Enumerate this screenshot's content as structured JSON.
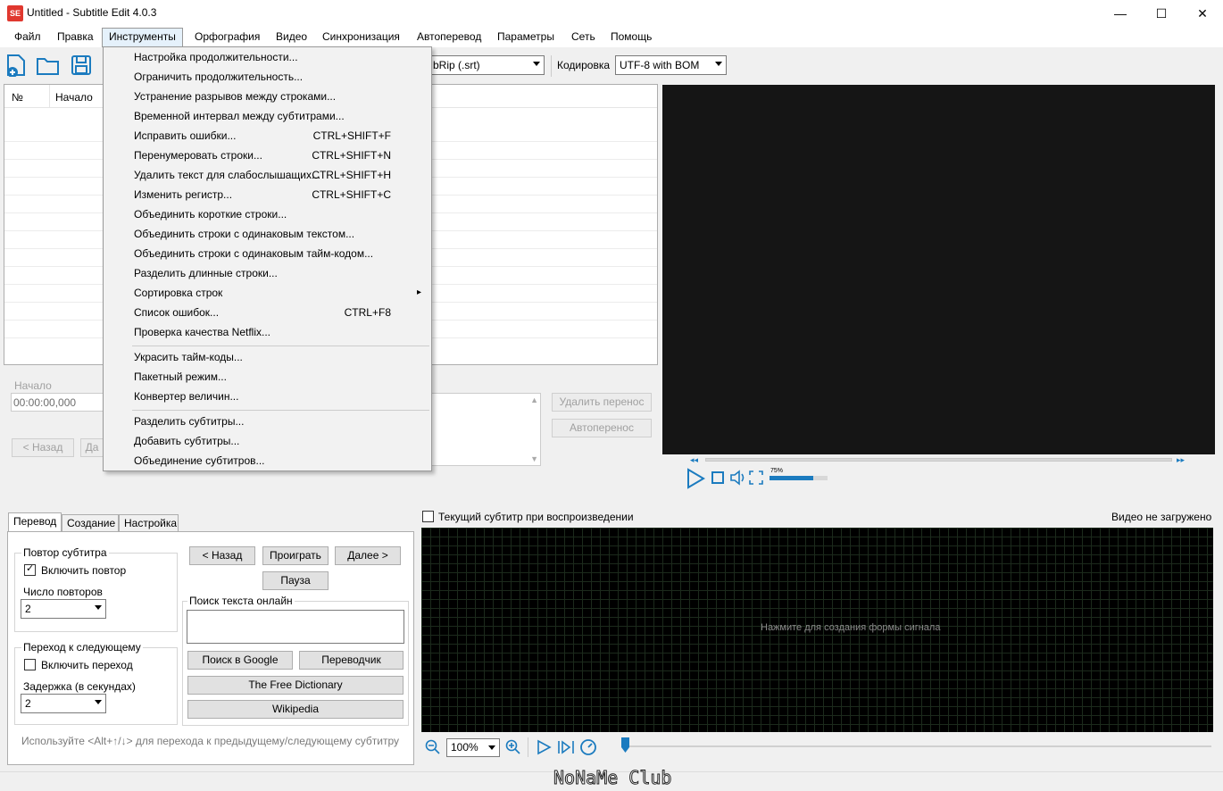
{
  "window": {
    "app_icon_text": "SE",
    "title": "Untitled - Subtitle Edit 4.0.3",
    "minimize": "—",
    "maximize": "☐",
    "close": "✕"
  },
  "menubar": {
    "items": [
      "Файл",
      "Правка",
      "Инструменты",
      "Орфография",
      "Видео",
      "Синхронизация",
      "Автоперевод",
      "Параметры",
      "Сеть",
      "Помощь"
    ]
  },
  "toolbar": {
    "format_value": "SubRip (.srt)",
    "format_visible": "bRip (.srt)",
    "encoding_label": "Кодировка",
    "encoding_value": "UTF-8 with BOM"
  },
  "list": {
    "col_number": "№",
    "col_start": "Начало"
  },
  "editor": {
    "start_label": "Начало",
    "start_value": "00:00:00,000",
    "prev_button": "< Назад",
    "next_partial": "Да",
    "remove_break": "Удалить перенос",
    "auto_break": "Автоперенос"
  },
  "tools_menu": {
    "items": [
      {
        "label": "Настройка продолжительности...",
        "shortcut": ""
      },
      {
        "label": "Ограничить продолжительность...",
        "shortcut": ""
      },
      {
        "label": "Устранение разрывов между строками...",
        "shortcut": ""
      },
      {
        "label": "Временной интервал между субтитрами...",
        "shortcut": ""
      },
      {
        "label": "Исправить ошибки...",
        "shortcut": "CTRL+SHIFT+F"
      },
      {
        "label": "Перенумеровать строки...",
        "shortcut": "CTRL+SHIFT+N"
      },
      {
        "label": "Удалить текст для слабослышащих...",
        "shortcut": "CTRL+SHIFT+H"
      },
      {
        "label": "Изменить регистр...",
        "shortcut": "CTRL+SHIFT+C"
      },
      {
        "label": "Объединить короткие строки...",
        "shortcut": ""
      },
      {
        "label": "Объединить строки с одинаковым текстом...",
        "shortcut": ""
      },
      {
        "label": "Объединить строки с одинаковым тайм-кодом...",
        "shortcut": ""
      },
      {
        "label": "Разделить длинные строки...",
        "shortcut": ""
      },
      {
        "label": "Сортировка строк",
        "shortcut": "▸"
      },
      {
        "label": "Список ошибок...",
        "shortcut": "CTRL+F8"
      },
      {
        "label": "Проверка качества Netflix...",
        "shortcut": ""
      },
      {
        "label": "Украсить тайм-коды...",
        "shortcut": ""
      },
      {
        "label": "Пакетный режим...",
        "shortcut": ""
      },
      {
        "label": "Конвертер величин...",
        "shortcut": ""
      },
      {
        "label": "Разделить субтитры...",
        "shortcut": ""
      },
      {
        "label": "Добавить субтитры...",
        "shortcut": ""
      },
      {
        "label": "Объединение субтитров...",
        "shortcut": ""
      }
    ]
  },
  "player": {
    "volume_percent": "75%",
    "volume_level": 0.75
  },
  "bottom": {
    "tabs": [
      "Перевод",
      "Создание",
      "Настройка"
    ],
    "repeat_group": "Повтор субтитра",
    "repeat_check": "Включить повтор",
    "repeat_count_label": "Число повторов",
    "repeat_count": "2",
    "next_group": "Переход к следующему",
    "next_check": "Включить переход",
    "delay_label": "Задержка (в секундах)",
    "delay_value": "2",
    "back_btn": "< Назад",
    "play_btn": "Проиграть",
    "next_btn": "Далее >",
    "pause_btn": "Пауза",
    "search_group": "Поиск текста онлайн",
    "google_btn": "Поиск в Google",
    "translator_btn": "Переводчик",
    "dictionary_btn": "The Free Dictionary",
    "wikipedia_btn": "Wikipedia",
    "hint": "Используйте <Alt+↑/↓> для перехода к предыдущему/следующему субтитру"
  },
  "waveform": {
    "current_sub_check": "Текущий субтитр при воспроизведении",
    "video_status": "Видео не загружено",
    "hint": "Нажмите для создания формы сигнала",
    "zoom": "100%"
  },
  "watermark": "NoNaMe Club"
}
